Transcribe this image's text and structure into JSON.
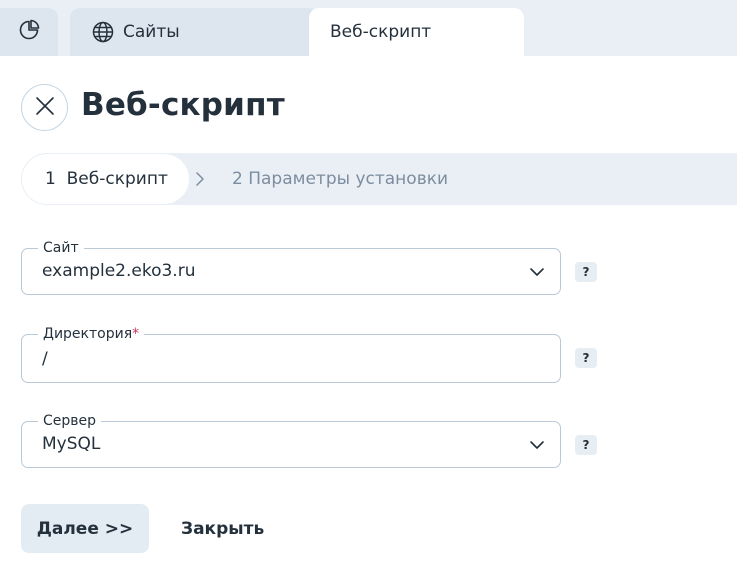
{
  "tabs": {
    "sites_label": "Сайты",
    "active_label": "Веб-скрипт"
  },
  "header": {
    "title": "Веб-скрипт"
  },
  "stepper": {
    "step1_number": "1",
    "step1_label": "Веб-скрипт",
    "step2_number": "2",
    "step2_label": "Параметры установки"
  },
  "form": {
    "site": {
      "label": "Сайт",
      "value": "example2.eko3.ru"
    },
    "directory": {
      "label": "Директория",
      "required_mark": "*",
      "value": "/"
    },
    "server": {
      "label": "Сервер",
      "value": "MySQL"
    },
    "help_glyph": "?"
  },
  "actions": {
    "next_label": "Далее >>",
    "close_label": "Закрыть"
  },
  "icons": {
    "dashboard": "pie-chart-icon",
    "sites": "globe-icon",
    "breadcrumb_separator": "chevron-right-icon",
    "close": "close-icon",
    "dropdown": "chevron-down-icon"
  },
  "colors": {
    "text": "#24313d",
    "muted_text": "#7c8d9f",
    "required": "#d2335c",
    "tabbar_bg": "#e9eff5",
    "field_border": "#b9c9d7"
  }
}
